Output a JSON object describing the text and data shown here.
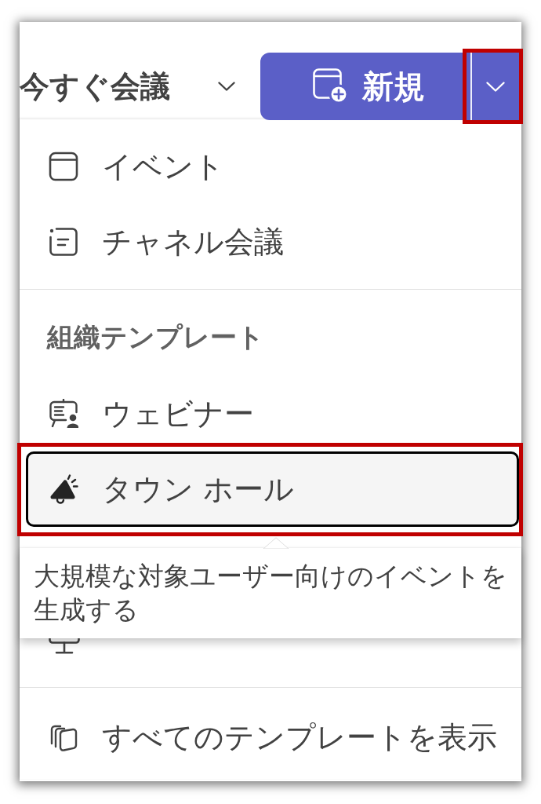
{
  "toolbar": {
    "meet_now": {
      "label": "今すぐ会議"
    },
    "new_button": {
      "label": "新規",
      "dropdown_annotated": true
    }
  },
  "menu": {
    "sections": [
      {
        "items": [
          {
            "label": "イベント",
            "selected": false,
            "annotated": false
          },
          {
            "label": "チャネル会議",
            "selected": false,
            "annotated": false
          }
        ]
      },
      {
        "heading": "組織テンプレート",
        "items": [
          {
            "label": "ウェビナー",
            "selected": false,
            "annotated": false
          },
          {
            "label": "タウン ホール",
            "selected": true,
            "annotated": true,
            "tooltip": "大規模な対象ユーザー向けのイベントを生成する"
          },
          {
            "selected": false,
            "annotated": false
          }
        ]
      },
      {
        "items": [
          {
            "label": "すべてのテンプレートを表示",
            "selected": false,
            "annotated": false
          }
        ]
      }
    ]
  }
}
